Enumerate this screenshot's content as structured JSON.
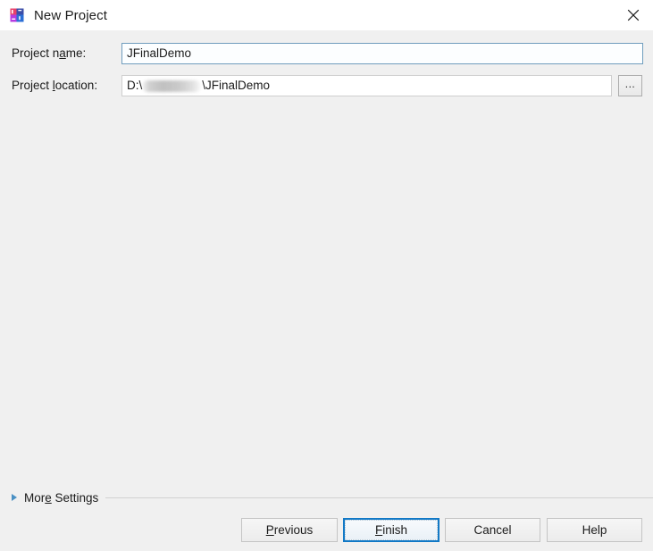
{
  "window": {
    "title": "New Project",
    "icon": "intellij-idea-icon",
    "close_label": "×",
    "close_icon": "close-icon"
  },
  "form": {
    "fields": [
      {
        "label_before": "Project n",
        "label_mnemonic": "a",
        "label_after": "me:",
        "label_full": "Project name:",
        "value": "JFinalDemo",
        "placeholder": ""
      },
      {
        "label_before": "Project ",
        "label_mnemonic": "l",
        "label_after": "ocation:",
        "label_full": "Project location:",
        "value_prefix": "D:\\",
        "value_suffix": "\\JFinalDemo",
        "value": "D:\\\\JFinalDemo",
        "placeholder": "",
        "redacted": true
      }
    ],
    "browse_button": {
      "label": "...",
      "icon": "ellipsis-icon"
    }
  },
  "more_settings": {
    "label_before": "Mor",
    "label_mnemonic": "e",
    "label_after": " Settings",
    "label_full": "More Settings",
    "expanded": false,
    "expander_icon": "triangle-right-icon"
  },
  "buttons": [
    {
      "name": "previous",
      "label_before": "",
      "label_mnemonic": "P",
      "label_after": "revious",
      "label_full": "Previous",
      "default": false
    },
    {
      "name": "finish",
      "label_before": "",
      "label_mnemonic": "F",
      "label_after": "inish",
      "label_full": "Finish",
      "default": true
    },
    {
      "name": "cancel",
      "label_before": "Cancel",
      "label_mnemonic": "",
      "label_after": "",
      "label_full": "Cancel",
      "default": false
    },
    {
      "name": "help",
      "label_before": "Help",
      "label_mnemonic": "",
      "label_after": "",
      "label_full": "Help",
      "default": false
    }
  ],
  "colors": {
    "dialog_background": "#f0f0f0",
    "titlebar_background": "#ffffff",
    "focus_border": "#1279c6",
    "input_focus_border": "#6f9dbd",
    "input_border": "#cfcfcf",
    "accent_expander": "#4a90c4",
    "separator": "#d2d2d2"
  }
}
